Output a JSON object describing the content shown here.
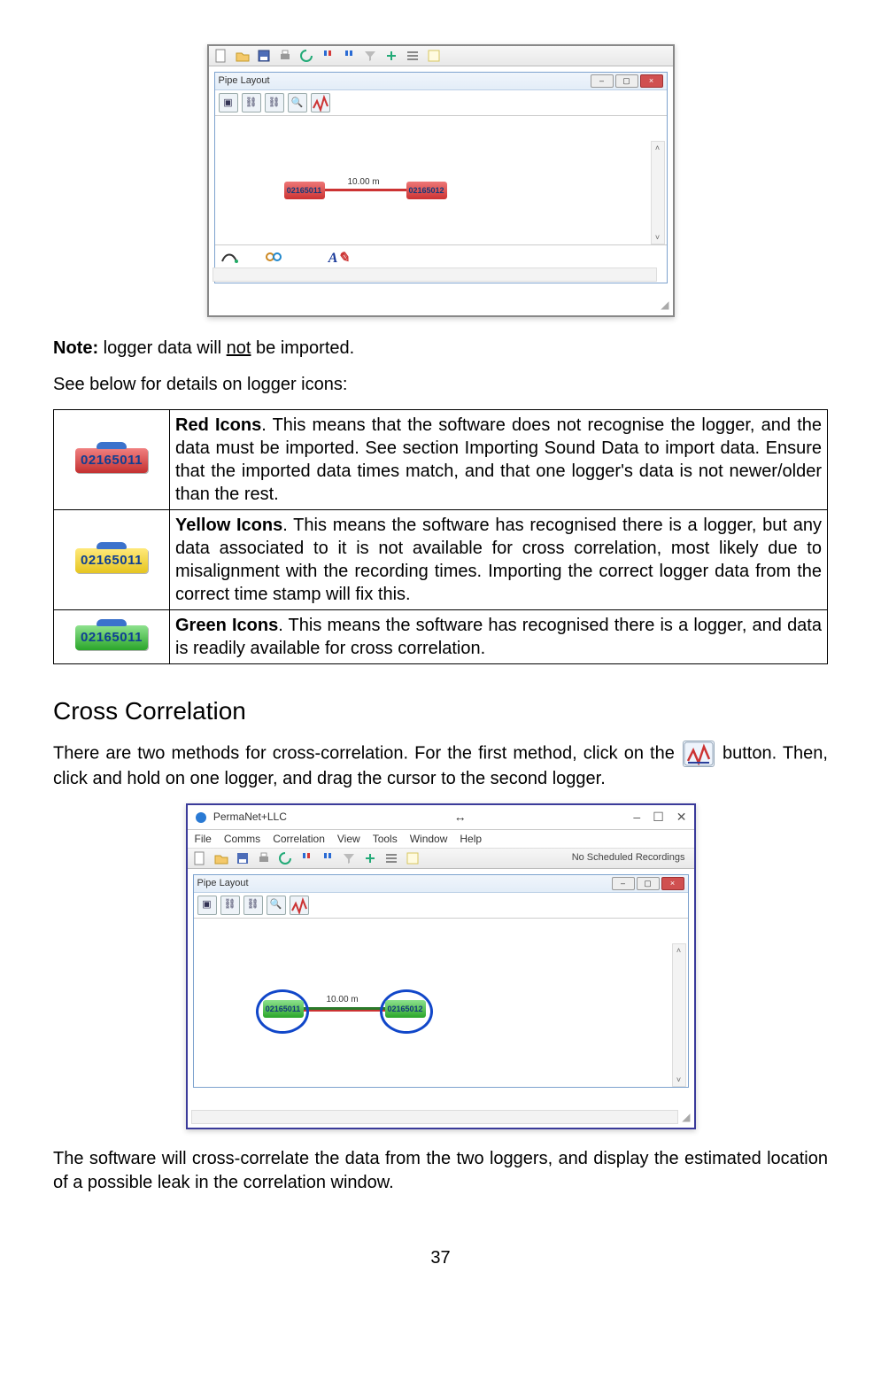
{
  "screenshot1": {
    "subwin_title": "Pipe Layout",
    "pipe_length": "10.00 m",
    "logger_left": "02165011",
    "logger_right": "02165012",
    "tools": {
      "pipe": "Pipe",
      "join": "Join",
      "text_comment": "Text Comment"
    }
  },
  "note_line": {
    "prefix": "Note:",
    "before": " logger data will ",
    "underlined": "not",
    "after": " be imported."
  },
  "see_below": "See below for details on logger icons:",
  "icons_table": {
    "serial": "02165011",
    "red": {
      "title": "Red Icons",
      "text": ". This means that the software does not recognise the logger, and the data must be imported. See section Importing Sound Data to import data. Ensure that the imported data times match, and that one logger's data is not newer/older than the rest."
    },
    "yellow": {
      "title": "Yellow Icons",
      "text": ". This means the software has recognised there is a logger, but any data associated to it is not available for cross correlation, most likely due to misalignment with the recording times. Importing the correct logger data from the correct time stamp will fix this."
    },
    "green": {
      "title": "Green Icons",
      "text": ". This means the software has recognised there is a logger, and data is readily available for cross correlation."
    }
  },
  "cc_heading": "Cross Correlation",
  "cc_para1a": "There are two methods for cross-correlation. For the first method, click on the ",
  "cc_para1b": " button. Then, click and hold on one logger, and drag the cursor to the second logger.",
  "screenshot2": {
    "app_title": "PermaNet+LLC",
    "menus": [
      "File",
      "Comms",
      "Correlation",
      "View",
      "Tools",
      "Window",
      "Help"
    ],
    "status_right": "No Scheduled Recordings",
    "subwin_title": "Pipe Layout",
    "pipe_length": "10.00 m",
    "logger_left": "02165011",
    "logger_right": "02165012"
  },
  "cc_para2": "The software will cross-correlate the data from the two loggers, and display the estimated location of a possible leak in the correlation window.",
  "page_number": "37"
}
